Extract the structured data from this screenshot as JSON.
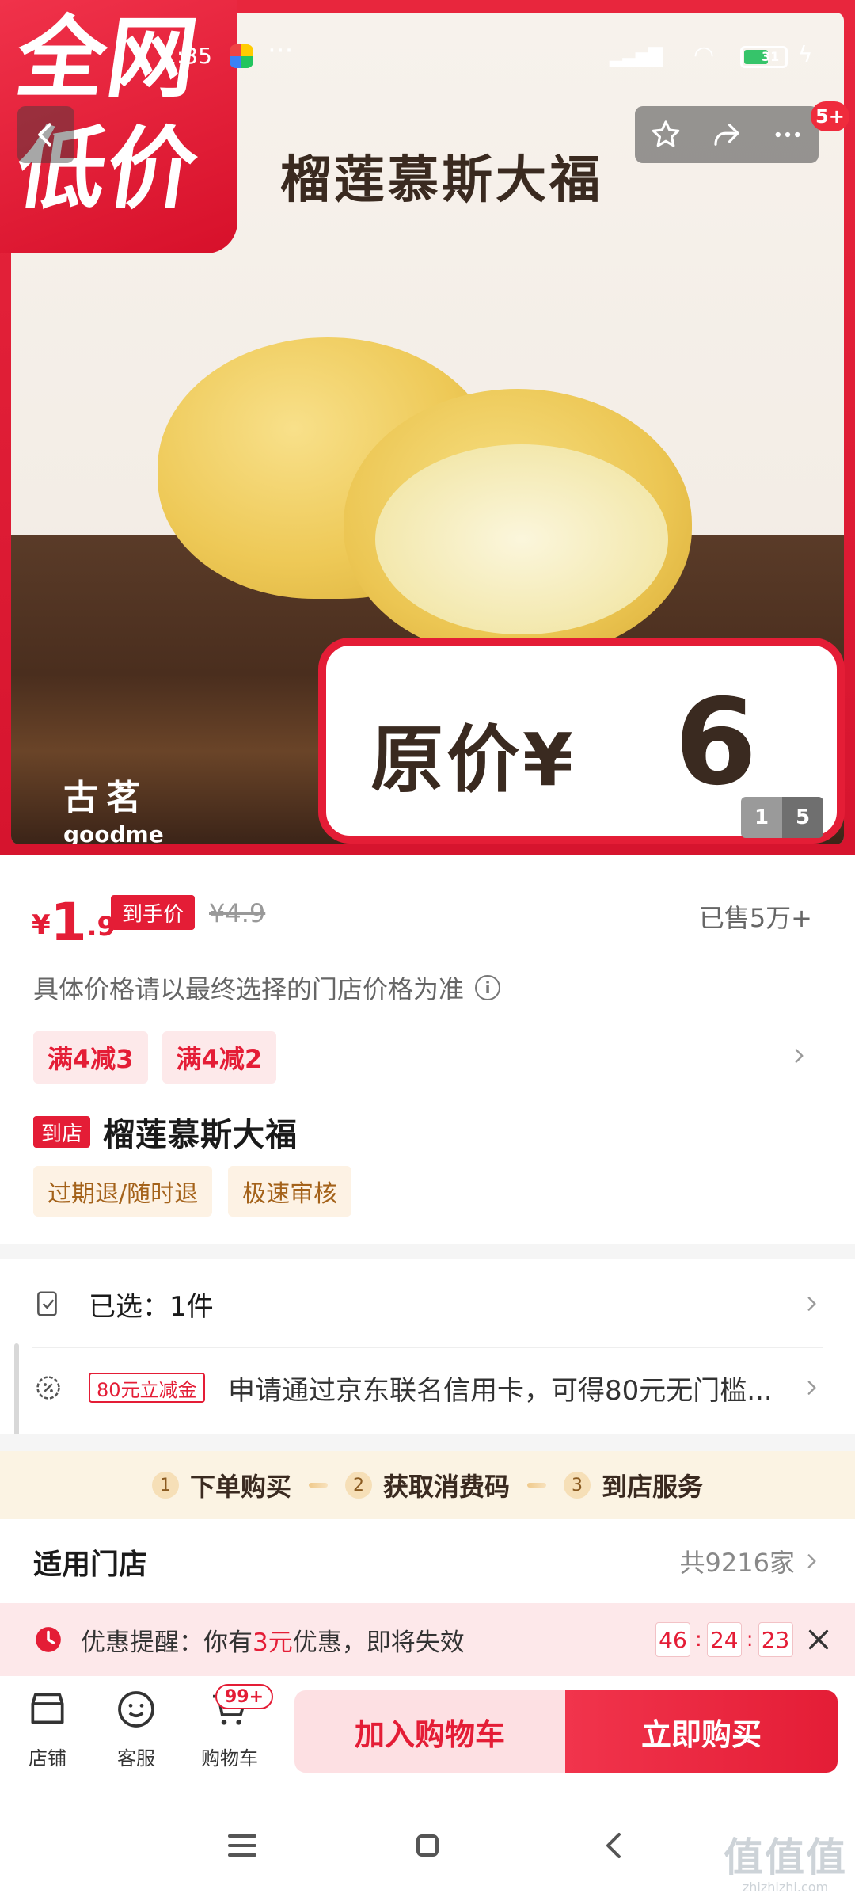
{
  "status_bar": {
    "time": "1:35",
    "battery": "31"
  },
  "hero": {
    "badge_line1": "全网",
    "badge_line2": "低价",
    "title": "榴莲慕斯大福",
    "brand_cn": "古茗",
    "brand_en": "goodme",
    "orig_label": "原价¥",
    "orig_price": "6",
    "pager_current": "1",
    "pager_total": "5",
    "notif_badge": "5+"
  },
  "price": {
    "yen": "¥",
    "int": "1",
    "dec": ".9",
    "tag": "到手价",
    "original": "¥4.9",
    "sold": "已售5万+"
  },
  "note": "具体价格请以最终选择的门店价格为准",
  "coupons": [
    "满4减3",
    "满4减2"
  ],
  "product": {
    "tag": "到店",
    "name": "榴莲慕斯大福"
  },
  "services": [
    "过期退/随时退",
    "极速审核"
  ],
  "selected": "已选：1件",
  "bank": {
    "tag": "80元立减金",
    "text": "申请通过京东联名信用卡，可得80元无门槛..."
  },
  "steps": [
    {
      "n": "1",
      "label": "下单购买"
    },
    {
      "n": "2",
      "label": "获取消费码"
    },
    {
      "n": "3",
      "label": "到店服务"
    }
  ],
  "stores": {
    "title": "适用门店",
    "count": "共9216家"
  },
  "reminder": {
    "prefix": "优惠提醒：你有",
    "amount": "3元",
    "suffix": "优惠，即将失效",
    "timer": [
      "46",
      "24",
      "23"
    ]
  },
  "bottom": {
    "shop": "店铺",
    "service": "客服",
    "cart": "购物车",
    "cart_badge": "99+",
    "add_cart": "加入购物车",
    "buy_now": "立即购买"
  },
  "watermark": {
    "big": "值值值",
    "small": "zhizhizhi.com"
  },
  "colors": {
    "accent": "#e41d36",
    "coupon_bg": "#fde9ea",
    "service_bg": "#fdf2e4",
    "steps_bg": "#fbf3e3"
  }
}
